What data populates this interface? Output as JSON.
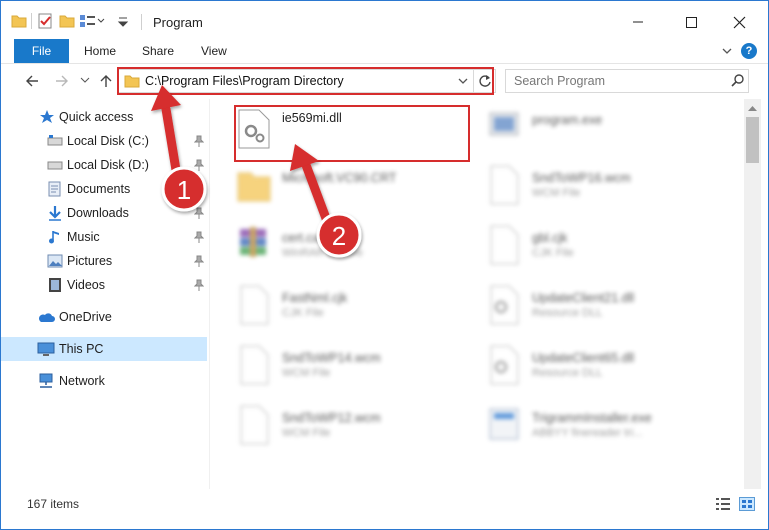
{
  "window": {
    "title": "Program"
  },
  "ribbon": {
    "tabs": [
      "File",
      "Home",
      "Share",
      "View"
    ]
  },
  "address": {
    "path": "C:\\Program Files\\Program Directory"
  },
  "search": {
    "placeholder": "Search Program"
  },
  "sidebar": {
    "items": [
      {
        "label": "Quick access",
        "icon": "star-icon",
        "pinned": false
      },
      {
        "label": "Local Disk (C:)",
        "icon": "drive-icon",
        "pinned": true
      },
      {
        "label": "Local Disk (D:)",
        "icon": "drive-icon",
        "pinned": true
      },
      {
        "label": "Documents",
        "icon": "documents-icon",
        "pinned": true
      },
      {
        "label": "Downloads",
        "icon": "download-icon",
        "pinned": true
      },
      {
        "label": "Music",
        "icon": "music-icon",
        "pinned": true
      },
      {
        "label": "Pictures",
        "icon": "pictures-icon",
        "pinned": true
      },
      {
        "label": "Videos",
        "icon": "videos-icon",
        "pinned": true
      },
      {
        "label": "OneDrive",
        "icon": "cloud-icon",
        "pinned": false
      },
      {
        "label": "This PC",
        "icon": "computer-icon",
        "pinned": false,
        "selected": true
      },
      {
        "label": "Network",
        "icon": "network-icon",
        "pinned": false
      }
    ]
  },
  "files": [
    {
      "name": "ie569mi.dll",
      "type": "",
      "icon": "dll-file-icon",
      "highlighted": true
    },
    {
      "name": "program.exe",
      "type": "",
      "icon": "exe-file-icon"
    },
    {
      "name": "Microsoft.VC90.CRT",
      "type": "",
      "icon": "folder-icon"
    },
    {
      "name": "SndToWP16.wcm",
      "type": "WCM File",
      "icon": "file-icon"
    },
    {
      "name": "cert.cab",
      "type": "WinRAR archive",
      "icon": "archive-icon"
    },
    {
      "name": "gbl.cjk",
      "type": "CJK File",
      "icon": "file-icon"
    },
    {
      "name": "FastNml.cjk",
      "type": "CJK File",
      "icon": "file-icon"
    },
    {
      "name": "UpdateClient21.dll",
      "type": "Resource DLL",
      "icon": "dll-file-icon"
    },
    {
      "name": "SndToWP14.wcm",
      "type": "WCM File",
      "icon": "file-icon"
    },
    {
      "name": "UpdateClient65.dll",
      "type": "Resource DLL",
      "icon": "dll-file-icon"
    },
    {
      "name": "SndToWP12.wcm",
      "type": "WCM File",
      "icon": "file-icon"
    },
    {
      "name": "TrigrammInstaller.exe",
      "type": "ABBYY finereader tri...",
      "icon": "exe-file-icon"
    }
  ],
  "status": {
    "count": "167 items"
  },
  "annotations": {
    "step1": "1",
    "step2": "2"
  },
  "colors": {
    "accent": "#1979ca",
    "highlight": "#d62d2d",
    "selected": "#cce8ff"
  }
}
